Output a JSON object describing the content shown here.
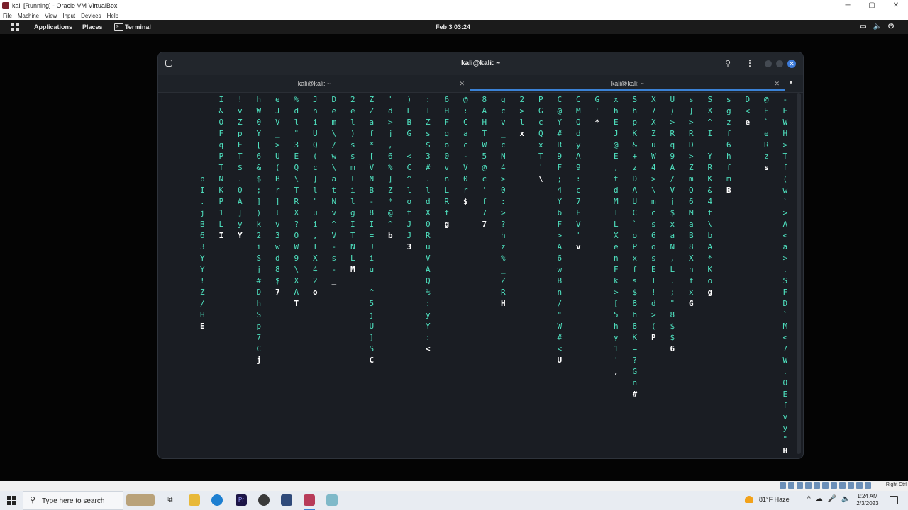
{
  "vbox": {
    "title": "kali [Running] - Oracle VM VirtualBox",
    "menu": [
      "File",
      "Machine",
      "View",
      "Input",
      "Devices",
      "Help"
    ],
    "controls": [
      "─",
      "▢",
      "✕"
    ],
    "status_right": "Right Ctrl"
  },
  "gnome": {
    "apps": "Applications",
    "places": "Places",
    "terminal": "Terminal",
    "clock": "Feb 3  03:24"
  },
  "terminal": {
    "title": "kali@kali: ~",
    "tabs": [
      {
        "label": "kali@kali: ~",
        "active": false
      },
      {
        "label": "kali@kali: ~",
        "active": true
      }
    ],
    "matrix_columns": [
      {
        "c": 2,
        "r": 7,
        "t": "p I . j B 6 3 Y Y ! Z / H E"
      },
      {
        "c": 3,
        "r": 0,
        "t": "I & O F q P T N K P 1 L I"
      },
      {
        "c": 4,
        "r": 0,
        "t": "! v Z p E T $ . 0 A ] y Y"
      },
      {
        "c": 5,
        "r": 0,
        "t": "h W 0 Y [ 6 & $ ; ] ) k 2 i S j # D h S p 7 C j"
      },
      {
        "c": 6,
        "r": 0,
        "t": "e J V _ > U ( B r ] l v 3 w d 8 $ 7"
      },
      {
        "c": 7,
        "r": 0,
        "t": "% d l \" 3 E Q \\ T R X ? O W 9 \\ X A T"
      },
      {
        "c": 8,
        "r": 0,
        "t": "J h i U Q ( c ] l \" u i , I X 4 2 o"
      },
      {
        "c": 9,
        "r": 0,
        "t": "D e m \\ / w \\ a t N v ^ V - s - _"
      },
      {
        "c": 10,
        "r": 0,
        "t": "2 e l ) s s m l i l g I T N L M"
      },
      {
        "c": 11,
        "r": 0,
        "t": "Z Z a f * [ V N B - 8 I = J i u _ ^ 5 j U ] S C"
      },
      {
        "c": 12,
        "r": 0,
        "t": "' d > j , 6 % ] Z * @ ^ b"
      },
      {
        "c": 13,
        "r": 0,
        "t": ") L B G _ < C ^ l o t J J 3"
      },
      {
        "c": 14,
        "r": 0,
        "t": ": I Z s $ 3 # . l d X 0 R u V A Q % : y Y : <"
      },
      {
        "c": 15,
        "r": 0,
        "t": "6 H F g o 0 v n L R f g"
      },
      {
        "c": 16,
        "r": 0,
        "t": "@ : C a c - V 0 r $"
      },
      {
        "c": 17,
        "r": 0,
        "t": "8 A H T W 5 @ c ' f 7 7"
      },
      {
        "c": 18,
        "r": 0,
        "t": "g c v _ c N 4 > 0 : > ? h z % _ Z R H"
      },
      {
        "c": 19,
        "r": 0,
        "t": "2 > l x"
      },
      {
        "c": 20,
        "r": 0,
        "t": "P G c Q x T ' \\"
      },
      {
        "c": 21,
        "r": 0,
        "t": "C @ Y # R 9 F ; 4 Y b F > A 6 w B n / \" W # < U"
      },
      {
        "c": 22,
        "r": 0,
        "t": "C M Q d y A 9 : c 7 F V ' v"
      },
      {
        "c": 23,
        "r": 0,
        "t": "G ' *"
      },
      {
        "c": 24,
        "r": 0,
        "t": "x h E J @ E , t d M T L X e n F k > [ 5 h y 1 ' ,"
      },
      {
        "c": 25,
        "r": 0,
        "t": "S h p K & + z D A U C ` o P x f s $ 8 h 8 K = ? G n #"
      },
      {
        "c": 26,
        "r": 0,
        "t": "X 7 X Z u W 4 > \\ m c s 6 o s E T ! d > ( P"
      },
      {
        "c": 27,
        "r": 0,
        "t": "U ) > R q 9 A / V j $ x a N , L . ; \" 8 $ $ 6"
      },
      {
        "c": 28,
        "r": 0,
        "t": "s ] > R D > Z m Q 6 M a B 8 X n f x G"
      },
      {
        "c": 29,
        "r": 0,
        "t": "S X ^ I _ Y R K & 4 t \\ b A * K o g"
      },
      {
        "c": 30,
        "r": 0,
        "t": "s g z f 6 h f m B"
      },
      {
        "c": 31,
        "r": 0,
        "t": "D < e"
      },
      {
        "c": 32,
        "r": 0,
        "t": "@ E ` e R z s"
      },
      {
        "c": 33,
        "r": 0,
        "t": "- E W H > T f ( w ` > A < a > . S F D ` M < 7 W . O E f v y \" H"
      }
    ]
  },
  "taskbar": {
    "search_placeholder": "Type here to search",
    "weather": "81°F  Haze",
    "time": "1:24 AM",
    "date": "2/3/2023"
  }
}
